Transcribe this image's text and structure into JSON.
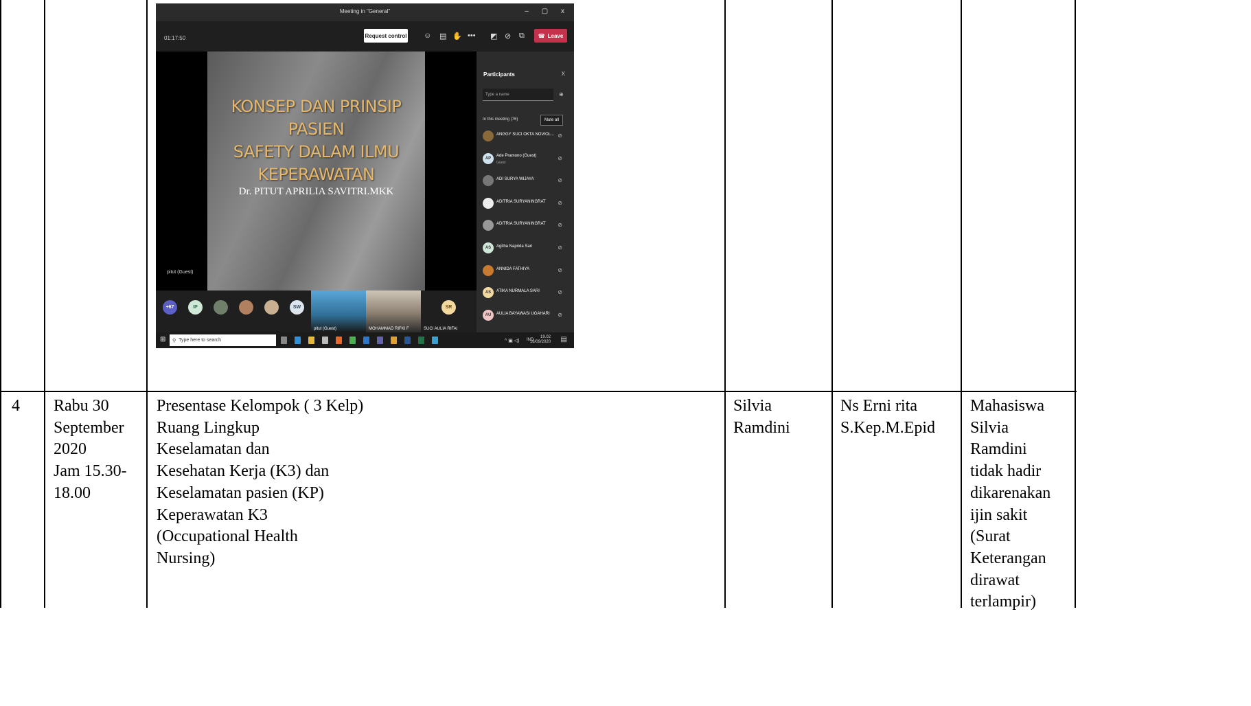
{
  "meeting": {
    "window_title": "Meeting in \"General\"",
    "window_controls": "– ▢ x",
    "timer": "01:17:50",
    "request_control": "Request control",
    "leave": "Leave",
    "slide_title": [
      "KONSEP DAN PRINSIP PASIEN",
      "SAFETY DALAM ILMU",
      "KEPERAWATAN"
    ],
    "slide_author": "Dr. PITUT APRILIA SAVITRI.MKK",
    "presenter_label": "pitut (Guest)",
    "strip_avatars": [
      "+67",
      "IP",
      "",
      "",
      "",
      "SW"
    ],
    "strip_tiles": [
      "pitut (Guest)",
      "MOHAMMAD RIFKI F",
      "SUCI AULIA RIFAI"
    ],
    "strip_sr": "SR",
    "taskbar_search": "Type here to search",
    "tray_lang": "IND",
    "tray_time": "19.02",
    "tray_date": "16/09/2020",
    "panel": {
      "title": "Participants",
      "close": "X",
      "search_placeholder": "Type a name",
      "in_meeting": "In this meeting (76)",
      "mute_all": "Mute all",
      "participants": [
        {
          "initials": "",
          "name": "ANGGY SUCI OKTA NOVIOL...",
          "sub": "",
          "color": "#8a6a3a"
        },
        {
          "initials": "AP",
          "name": "Ade Pramono (Guest)",
          "sub": "Guest",
          "color": "#cfe3ee"
        },
        {
          "initials": "",
          "name": "ADI SURYA WIJAYA",
          "sub": "",
          "color": "#777777"
        },
        {
          "initials": "",
          "name": "ADITRIA SURYANINGRAT",
          "sub": "",
          "color": "#eeeeee"
        },
        {
          "initials": "",
          "name": "ADITRIA SURYANINGRAT",
          "sub": "",
          "color": "#999999"
        },
        {
          "initials": "AS",
          "name": "Agitha Naprida Sari",
          "sub": "",
          "color": "#cfe8d8"
        },
        {
          "initials": "",
          "name": "ANNIDA FATHIYA",
          "sub": "",
          "color": "#c87a30"
        },
        {
          "initials": "AS",
          "name": "ATIKA NURMALA SARI",
          "sub": "",
          "color": "#f3d9a0"
        },
        {
          "initials": "AU",
          "name": "AULIA BAYAWASI UGAHARI",
          "sub": "",
          "color": "#f1c5c5"
        }
      ]
    }
  },
  "row": {
    "no": "4",
    "date_lines": [
      "Rabu 30",
      "September",
      "2020",
      "Jam 15.30-",
      "18.00"
    ],
    "topic_lines": [
      "Presentase Kelompok ( 3 Kelp)",
      "Ruang Lingkup",
      "Keselamatan dan",
      "Kesehatan Kerja (K3) dan",
      "Keselamatan pasien (KP)",
      "Keperawatan K3",
      "(Occupational Health",
      "Nursing)"
    ],
    "student_lines": [
      "Silvia",
      "Ramdini"
    ],
    "lecturer_lines": [
      "Ns Erni rita",
      "S.Kep.M.Epid"
    ],
    "note_lines": [
      "Mahasiswa",
      "Silvia",
      "Ramdini",
      "tidak hadir",
      "dikarenakan",
      "ijin sakit",
      "(Surat",
      "Keterangan",
      "dirawat",
      "terlampir)"
    ]
  }
}
